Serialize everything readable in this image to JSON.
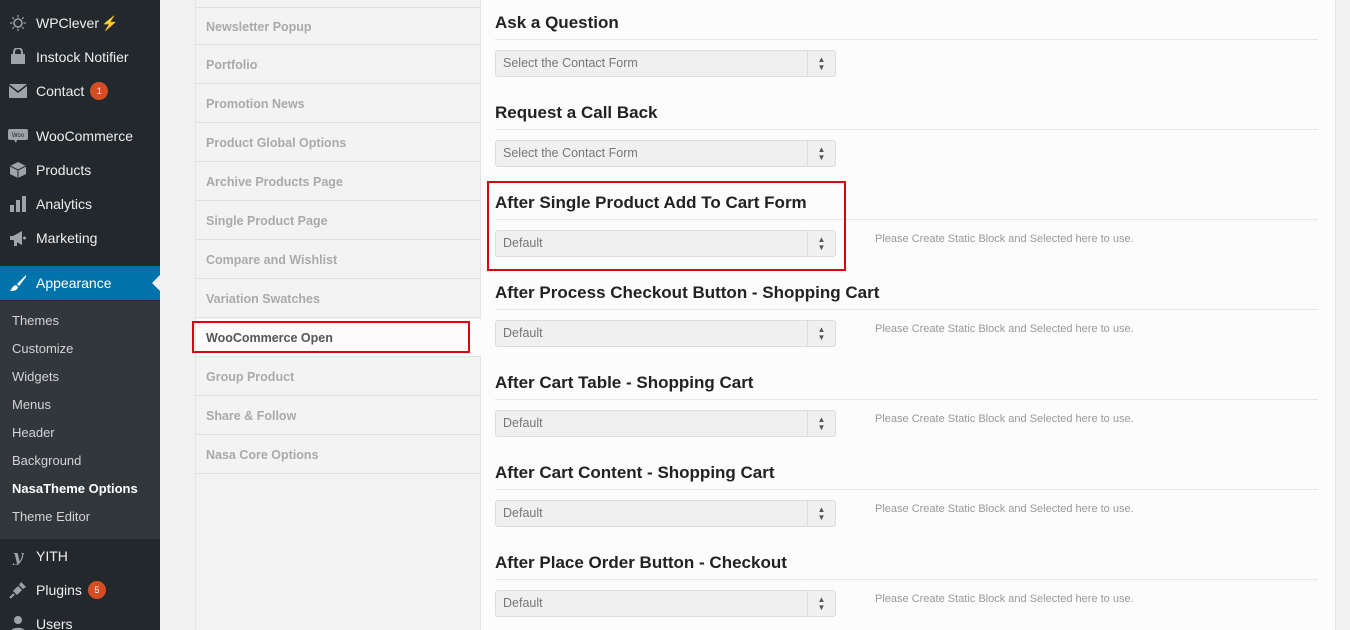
{
  "admin_menu": {
    "items": [
      {
        "label": "WPClever",
        "icon": "wpclever-icon",
        "bolt": "⚡"
      },
      {
        "label": "Instock Notifier",
        "icon": "instock-notifier-icon"
      },
      {
        "label": "Contact",
        "icon": "mail-icon",
        "count": "1"
      },
      {
        "label": "WooCommerce",
        "icon": "woocommerce-icon"
      },
      {
        "label": "Products",
        "icon": "products-icon"
      },
      {
        "label": "Analytics",
        "icon": "analytics-icon"
      },
      {
        "label": "Marketing",
        "icon": "megaphone-icon"
      },
      {
        "label": "Appearance",
        "icon": "paintbrush-icon"
      },
      {
        "label": "YITH",
        "icon": "yith-icon"
      },
      {
        "label": "Plugins",
        "icon": "plugins-icon",
        "count": "5"
      },
      {
        "label": "Users",
        "icon": "users-icon"
      }
    ],
    "appearance_submenu": [
      "Themes",
      "Customize",
      "Widgets",
      "Menus",
      "Header",
      "Background",
      "NasaTheme Options",
      "Theme Editor"
    ],
    "active_submenu": "NasaTheme Options"
  },
  "options_nav": {
    "items": [
      "Newsletter Popup",
      "Portfolio",
      "Promotion News",
      "Product Global Options",
      "Archive Products Page",
      "Single Product Page",
      "Compare and Wishlist",
      "Variation Swatches",
      "WooCommerce Open",
      "Group Product",
      "Share & Follow",
      "Nasa Core Options"
    ],
    "active": "WooCommerce Open"
  },
  "fields": [
    {
      "title": "Ask a Question",
      "value": "Select the Contact Form",
      "desc": ""
    },
    {
      "title": "Request a Call Back",
      "value": "Select the Contact Form",
      "desc": ""
    },
    {
      "title": "After Single Product Add To Cart Form",
      "value": "Default",
      "desc": "Please Create Static Block and Selected here to use."
    },
    {
      "title": "After Process Checkout Button - Shopping Cart",
      "value": "Default",
      "desc": "Please Create Static Block and Selected here to use."
    },
    {
      "title": "After Cart Table - Shopping Cart",
      "value": "Default",
      "desc": "Please Create Static Block and Selected here to use."
    },
    {
      "title": "After Cart Content - Shopping Cart",
      "value": "Default",
      "desc": "Please Create Static Block and Selected here to use."
    },
    {
      "title": "After Place Order Button - Checkout",
      "value": "Default",
      "desc": "Please Create Static Block and Selected here to use."
    }
  ],
  "colors": {
    "sidebar_bg": "#23282d",
    "submenu_bg": "#32373c",
    "accent": "#0073aa",
    "badge": "#d54e21",
    "highlight": "#e0000f"
  }
}
